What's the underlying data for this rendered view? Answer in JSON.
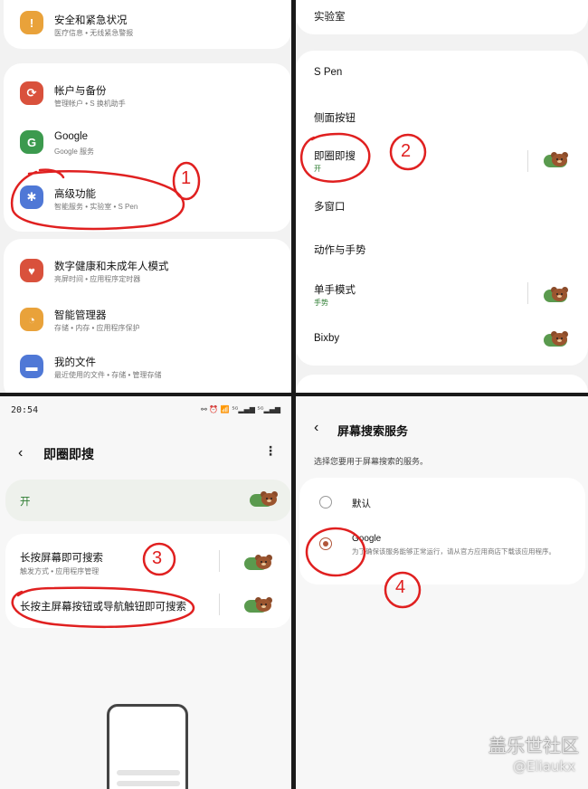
{
  "panel1": {
    "items": [
      {
        "title": "安全和紧急状况",
        "subtitle": "医疗信息 • 无线紧急警报",
        "icon": "emergency-icon",
        "color": "#e9a23a"
      },
      {
        "title": "帐户与备份",
        "subtitle": "管理帐户 • S 换机助手",
        "icon": "sync-icon",
        "color": "#d9513c"
      },
      {
        "title": "Google",
        "subtitle": "Google 服务",
        "icon": "google-icon",
        "color": "#3c9a4e"
      },
      {
        "title": "高级功能",
        "subtitle": "智能服务 • 实验室 • S Pen",
        "icon": "gear-plus-icon",
        "color": "#4f78d6"
      },
      {
        "title": "数字健康和未成年人模式",
        "subtitle": "亮屏时间 • 应用程序定时器",
        "icon": "wellbeing-icon",
        "color": "#d9513c"
      },
      {
        "title": "智能管理器",
        "subtitle": "存储 • 内存 • 应用程序保护",
        "icon": "device-care-icon",
        "color": "#e9a23a"
      },
      {
        "title": "我的文件",
        "subtitle": "最近使用的文件 • 存储 • 管理存储",
        "icon": "folder-icon",
        "color": "#4f78d6"
      }
    ],
    "annotation": "1"
  },
  "panel2": {
    "items": [
      {
        "title": "实验室",
        "subtitle": ""
      },
      {
        "title": "S Pen",
        "subtitle": ""
      },
      {
        "title": "侧面按钮",
        "subtitle": ""
      },
      {
        "title": "即圈即搜",
        "subtitle": "开",
        "toggle": true
      },
      {
        "title": "多窗口",
        "subtitle": ""
      },
      {
        "title": "动作与手势",
        "subtitle": ""
      },
      {
        "title": "单手模式",
        "subtitle": "手势",
        "toggle": true
      },
      {
        "title": "Bixby",
        "subtitle": "",
        "toggle": true
      }
    ],
    "annotation": "2"
  },
  "panel3": {
    "status_time": "20:54",
    "status_icons": "⚯ ⏰ 📶 ⁵ᴳ▂▄▆ ⁵ᴳ▂▄▆",
    "title": "即圈即搜",
    "master_label": "开",
    "options": [
      {
        "title": "长按屏幕即可搜索",
        "subtitle": "触发方式 • 应用程序管理"
      },
      {
        "title": "长按主屏幕按钮或导航触钮即可搜索",
        "subtitle": ""
      }
    ],
    "annotation": "3"
  },
  "panel4": {
    "title": "屏幕搜索服务",
    "description": "选择您要用于屏幕搜索的服务。",
    "options": [
      {
        "title": "默认",
        "subtitle": "",
        "selected": false
      },
      {
        "title": "Google",
        "subtitle": "为了确保该服务能够正常运行，请从官方应用商店下载该应用程序。",
        "selected": true
      }
    ],
    "annotation": "4",
    "watermark": "盖乐世社区",
    "watermark_user": "@Eliaukx"
  },
  "colors": {
    "accent_green": "#5a9a4e",
    "annotation_red": "#e02020",
    "radio_selected": "#b0563a"
  }
}
